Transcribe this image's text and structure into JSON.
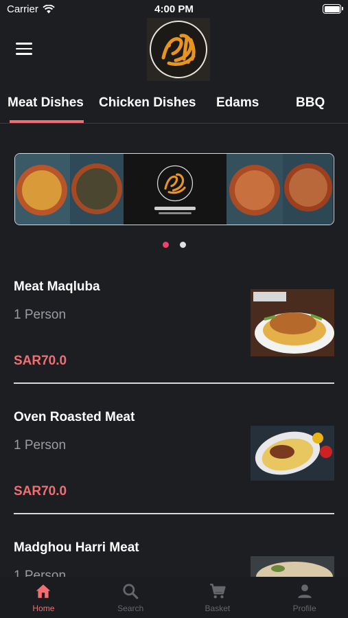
{
  "status_bar": {
    "carrier": "Carrier",
    "time": "4:00 PM"
  },
  "tabs": [
    {
      "label": "Meat Dishes"
    },
    {
      "label": "Chicken Dishes"
    },
    {
      "label": "Edams"
    },
    {
      "label": "BBQ"
    }
  ],
  "active_tab": "Meat Dishes",
  "carousel": {
    "page_count": 2,
    "active_page": 1
  },
  "items": [
    {
      "name": "Meat Maqluba",
      "portion": "1 Person",
      "price": "SAR70.0"
    },
    {
      "name": "Oven Roasted Meat",
      "portion": "1 Person",
      "price": "SAR70.0"
    },
    {
      "name": "Madghou Harri Meat",
      "portion": "1 Person"
    }
  ],
  "bottom_nav": [
    {
      "label": "Home",
      "icon": "home-icon"
    },
    {
      "label": "Search",
      "icon": "search-icon"
    },
    {
      "label": "Basket",
      "icon": "cart-icon"
    },
    {
      "label": "Profile",
      "icon": "person-icon"
    }
  ],
  "colors": {
    "accent": "#f16f72",
    "background": "#1d1e22",
    "muted_text": "#9b9ca1",
    "logo_gold": "#e8951f"
  }
}
